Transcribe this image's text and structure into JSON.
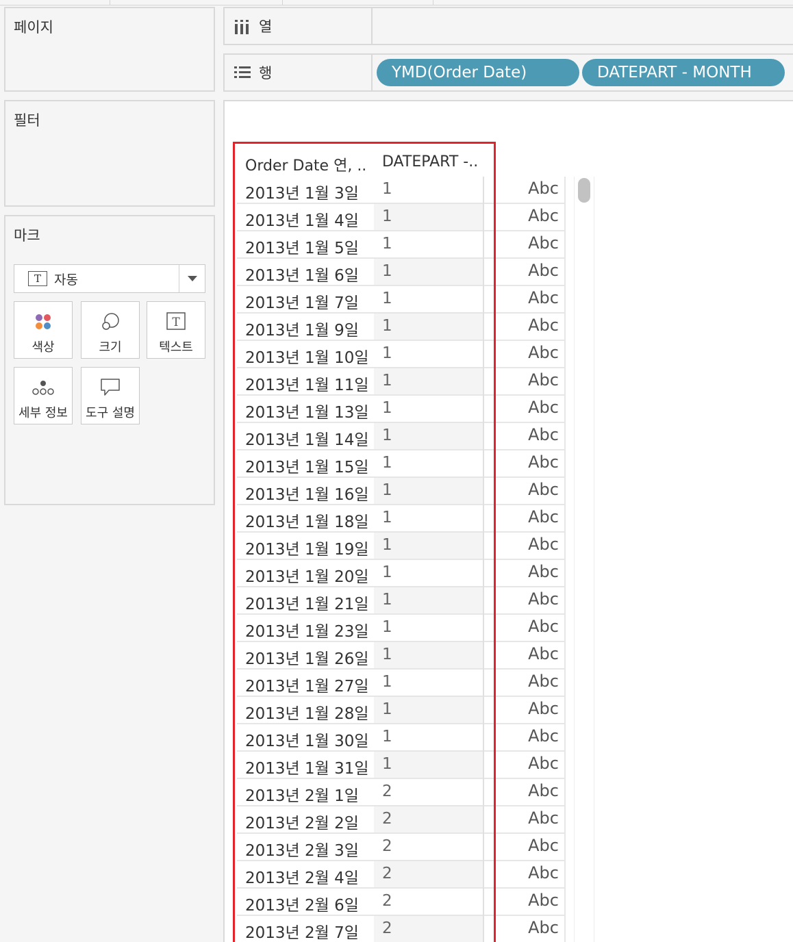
{
  "panels": {
    "pages": "페이지",
    "filters": "필터",
    "marks": "마크"
  },
  "shelves": {
    "columns_label": "열",
    "rows_label": "행",
    "row_pills": [
      "YMD(Order Date)",
      "DATEPART - MONTH"
    ]
  },
  "marks_card": {
    "mark_type": "자동",
    "buttons": [
      "색상",
      "크기",
      "텍스트",
      "세부 정보",
      "도구 설명"
    ]
  },
  "table": {
    "headers": [
      "Order Date 연, ..",
      "DATEPART -.."
    ],
    "placeholder": "Abc",
    "rows": [
      {
        "date": "2013년 1월 3일",
        "month": "1"
      },
      {
        "date": "2013년 1월 4일",
        "month": "1"
      },
      {
        "date": "2013년 1월 5일",
        "month": "1"
      },
      {
        "date": "2013년 1월 6일",
        "month": "1"
      },
      {
        "date": "2013년 1월 7일",
        "month": "1"
      },
      {
        "date": "2013년 1월 9일",
        "month": "1"
      },
      {
        "date": "2013년 1월 10일",
        "month": "1"
      },
      {
        "date": "2013년 1월 11일",
        "month": "1"
      },
      {
        "date": "2013년 1월 13일",
        "month": "1"
      },
      {
        "date": "2013년 1월 14일",
        "month": "1"
      },
      {
        "date": "2013년 1월 15일",
        "month": "1"
      },
      {
        "date": "2013년 1월 16일",
        "month": "1"
      },
      {
        "date": "2013년 1월 18일",
        "month": "1"
      },
      {
        "date": "2013년 1월 19일",
        "month": "1"
      },
      {
        "date": "2013년 1월 20일",
        "month": "1"
      },
      {
        "date": "2013년 1월 21일",
        "month": "1"
      },
      {
        "date": "2013년 1월 23일",
        "month": "1"
      },
      {
        "date": "2013년 1월 26일",
        "month": "1"
      },
      {
        "date": "2013년 1월 27일",
        "month": "1"
      },
      {
        "date": "2013년 1월 28일",
        "month": "1"
      },
      {
        "date": "2013년 1월 30일",
        "month": "1"
      },
      {
        "date": "2013년 1월 31일",
        "month": "1"
      },
      {
        "date": "2013년 2월 1일",
        "month": "2"
      },
      {
        "date": "2013년 2월 2일",
        "month": "2"
      },
      {
        "date": "2013년 2월 3일",
        "month": "2"
      },
      {
        "date": "2013년 2월 4일",
        "month": "2"
      },
      {
        "date": "2013년 2월 6일",
        "month": "2"
      },
      {
        "date": "2013년 2월 7일",
        "month": "2"
      }
    ]
  },
  "colors": {
    "pill": "#4d9ab4",
    "highlight": "#e32229"
  }
}
